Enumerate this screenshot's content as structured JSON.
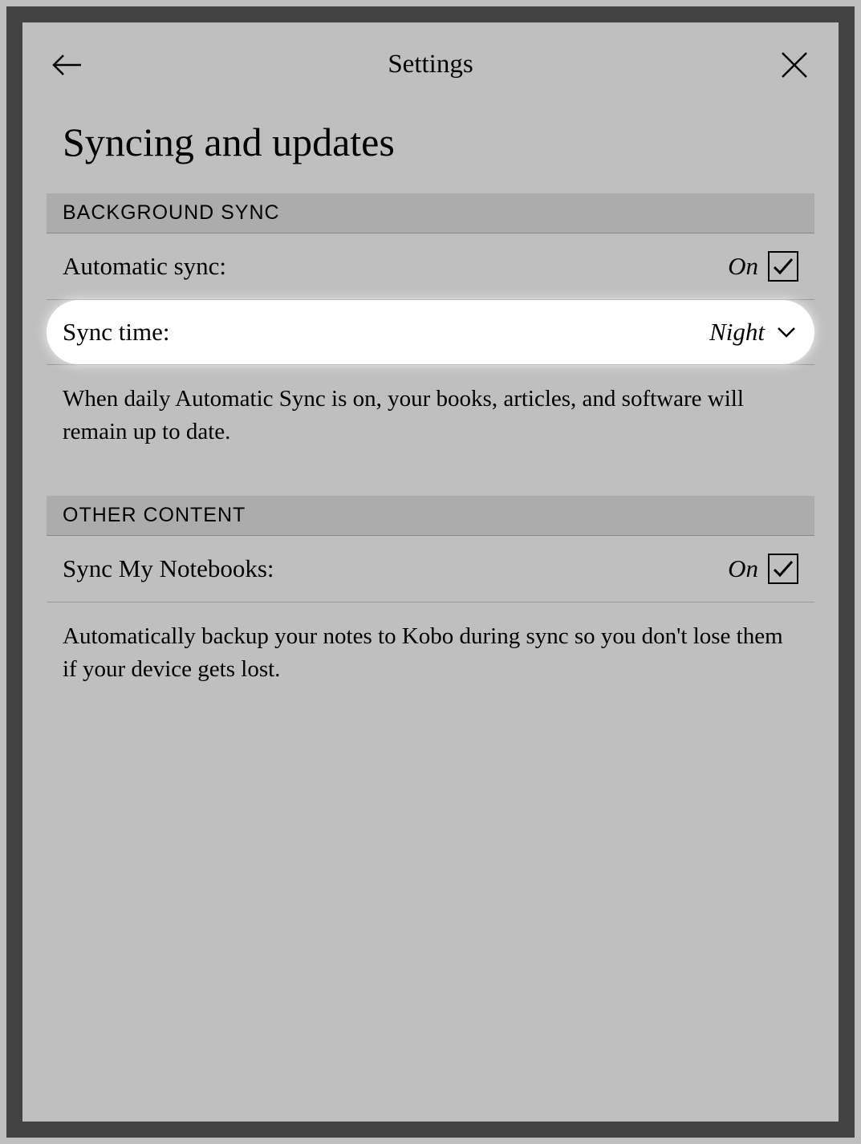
{
  "header": {
    "title": "Settings"
  },
  "page": {
    "title": "Syncing and updates"
  },
  "sections": {
    "background_sync": {
      "header": "BACKGROUND SYNC",
      "automatic_sync": {
        "label": "Automatic sync:",
        "value": "On"
      },
      "sync_time": {
        "label": "Sync time:",
        "value": "Night"
      },
      "description": "When daily Automatic Sync is on, your books, articles, and software will remain up to date."
    },
    "other_content": {
      "header": "OTHER CONTENT",
      "sync_notebooks": {
        "label": "Sync My Notebooks:",
        "value": "On"
      },
      "description": "Automatically backup your notes to Kobo during sync so you don't lose them if your device gets lost."
    }
  }
}
